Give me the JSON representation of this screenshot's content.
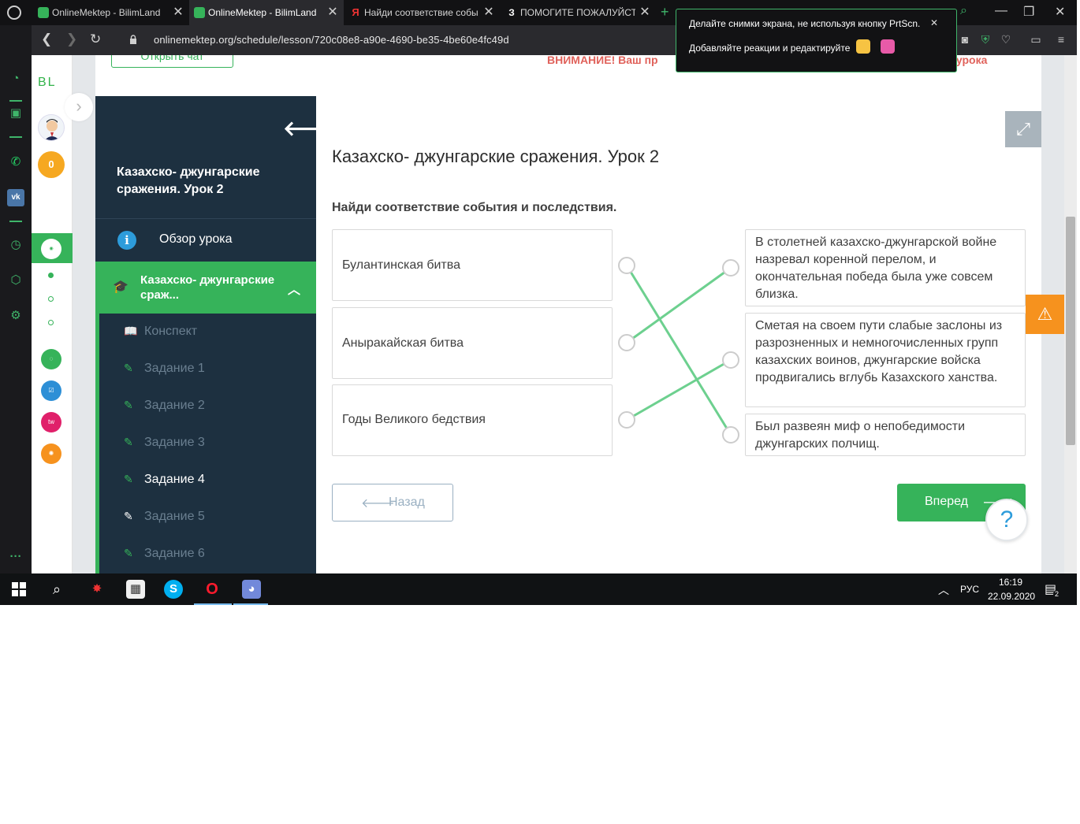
{
  "browser": {
    "tabs": [
      {
        "title": "OnlineMektep - BilimLand",
        "active": false
      },
      {
        "title": "OnlineMektep - BilimLand",
        "active": true
      },
      {
        "title": "Найди соответствие собы",
        "active": false
      },
      {
        "title": "ПОМОГИТЕ ПОЖАЛУЙСТ",
        "active": false
      }
    ],
    "url": "onlinemektep.org/schedule/lesson/720c08e8-a90e-4690-be35-4be60e4fc49d"
  },
  "toast": {
    "line1": "Делайте снимки экрана, не используя кнопку PrtScn.",
    "line2": "Добавляйте реакции и редактируйте"
  },
  "rail": {
    "logo": "BL",
    "coins": "0"
  },
  "header": {
    "chat_button": "Открыть чат",
    "warning_left": "ВНИМАНИЕ! Ваш пр",
    "warning_right": "ения урока"
  },
  "lesson_nav": {
    "title": "Казахско- джунгарские сражения. Урок 2",
    "overview": "Обзор урока",
    "section": "Казахско- джунгарские сраж...",
    "items": [
      {
        "label": "Конспект",
        "state": "normal"
      },
      {
        "label": "Задание 1",
        "state": "normal"
      },
      {
        "label": "Задание 2",
        "state": "normal"
      },
      {
        "label": "Задание 3",
        "state": "normal"
      },
      {
        "label": "Задание 4",
        "state": "current"
      },
      {
        "label": "Задание 5",
        "state": "done"
      },
      {
        "label": "Задание 6",
        "state": "normal"
      }
    ]
  },
  "exercise": {
    "title": "Казахско- джунгарские сражения. Урок 2",
    "instruction": "Найди соответствие события и последствия.",
    "left": [
      "Булантинская битва",
      "Аныракайская битва",
      "Годы Великого бедствия"
    ],
    "right": [
      "В столетней казахско-джунгарской войне назревал коренной перелом, и окончательная победа была уже совсем близка.",
      "Сметая на своем пути слабые заслоны из разрозненных и немногочисленных групп казахских воинов, джунгарские войска продвигались вглубь Казахского ханства.",
      "Был развеян миф о непобедимости джунгарских полчищ."
    ],
    "matches": [
      [
        0,
        2
      ],
      [
        1,
        0
      ],
      [
        2,
        1
      ]
    ],
    "back_button": "Назад",
    "next_button": "Вперед",
    "help": "?"
  },
  "taskbar": {
    "lang": "РУС",
    "time": "16:19",
    "date": "22.09.2020",
    "notifications": "2"
  },
  "colors": {
    "accent_green": "#36b35a",
    "nav_dark": "#1d3040",
    "warning_red": "#e0625b",
    "warning_orange": "#f6921e",
    "line_green": "#6dd08f"
  }
}
